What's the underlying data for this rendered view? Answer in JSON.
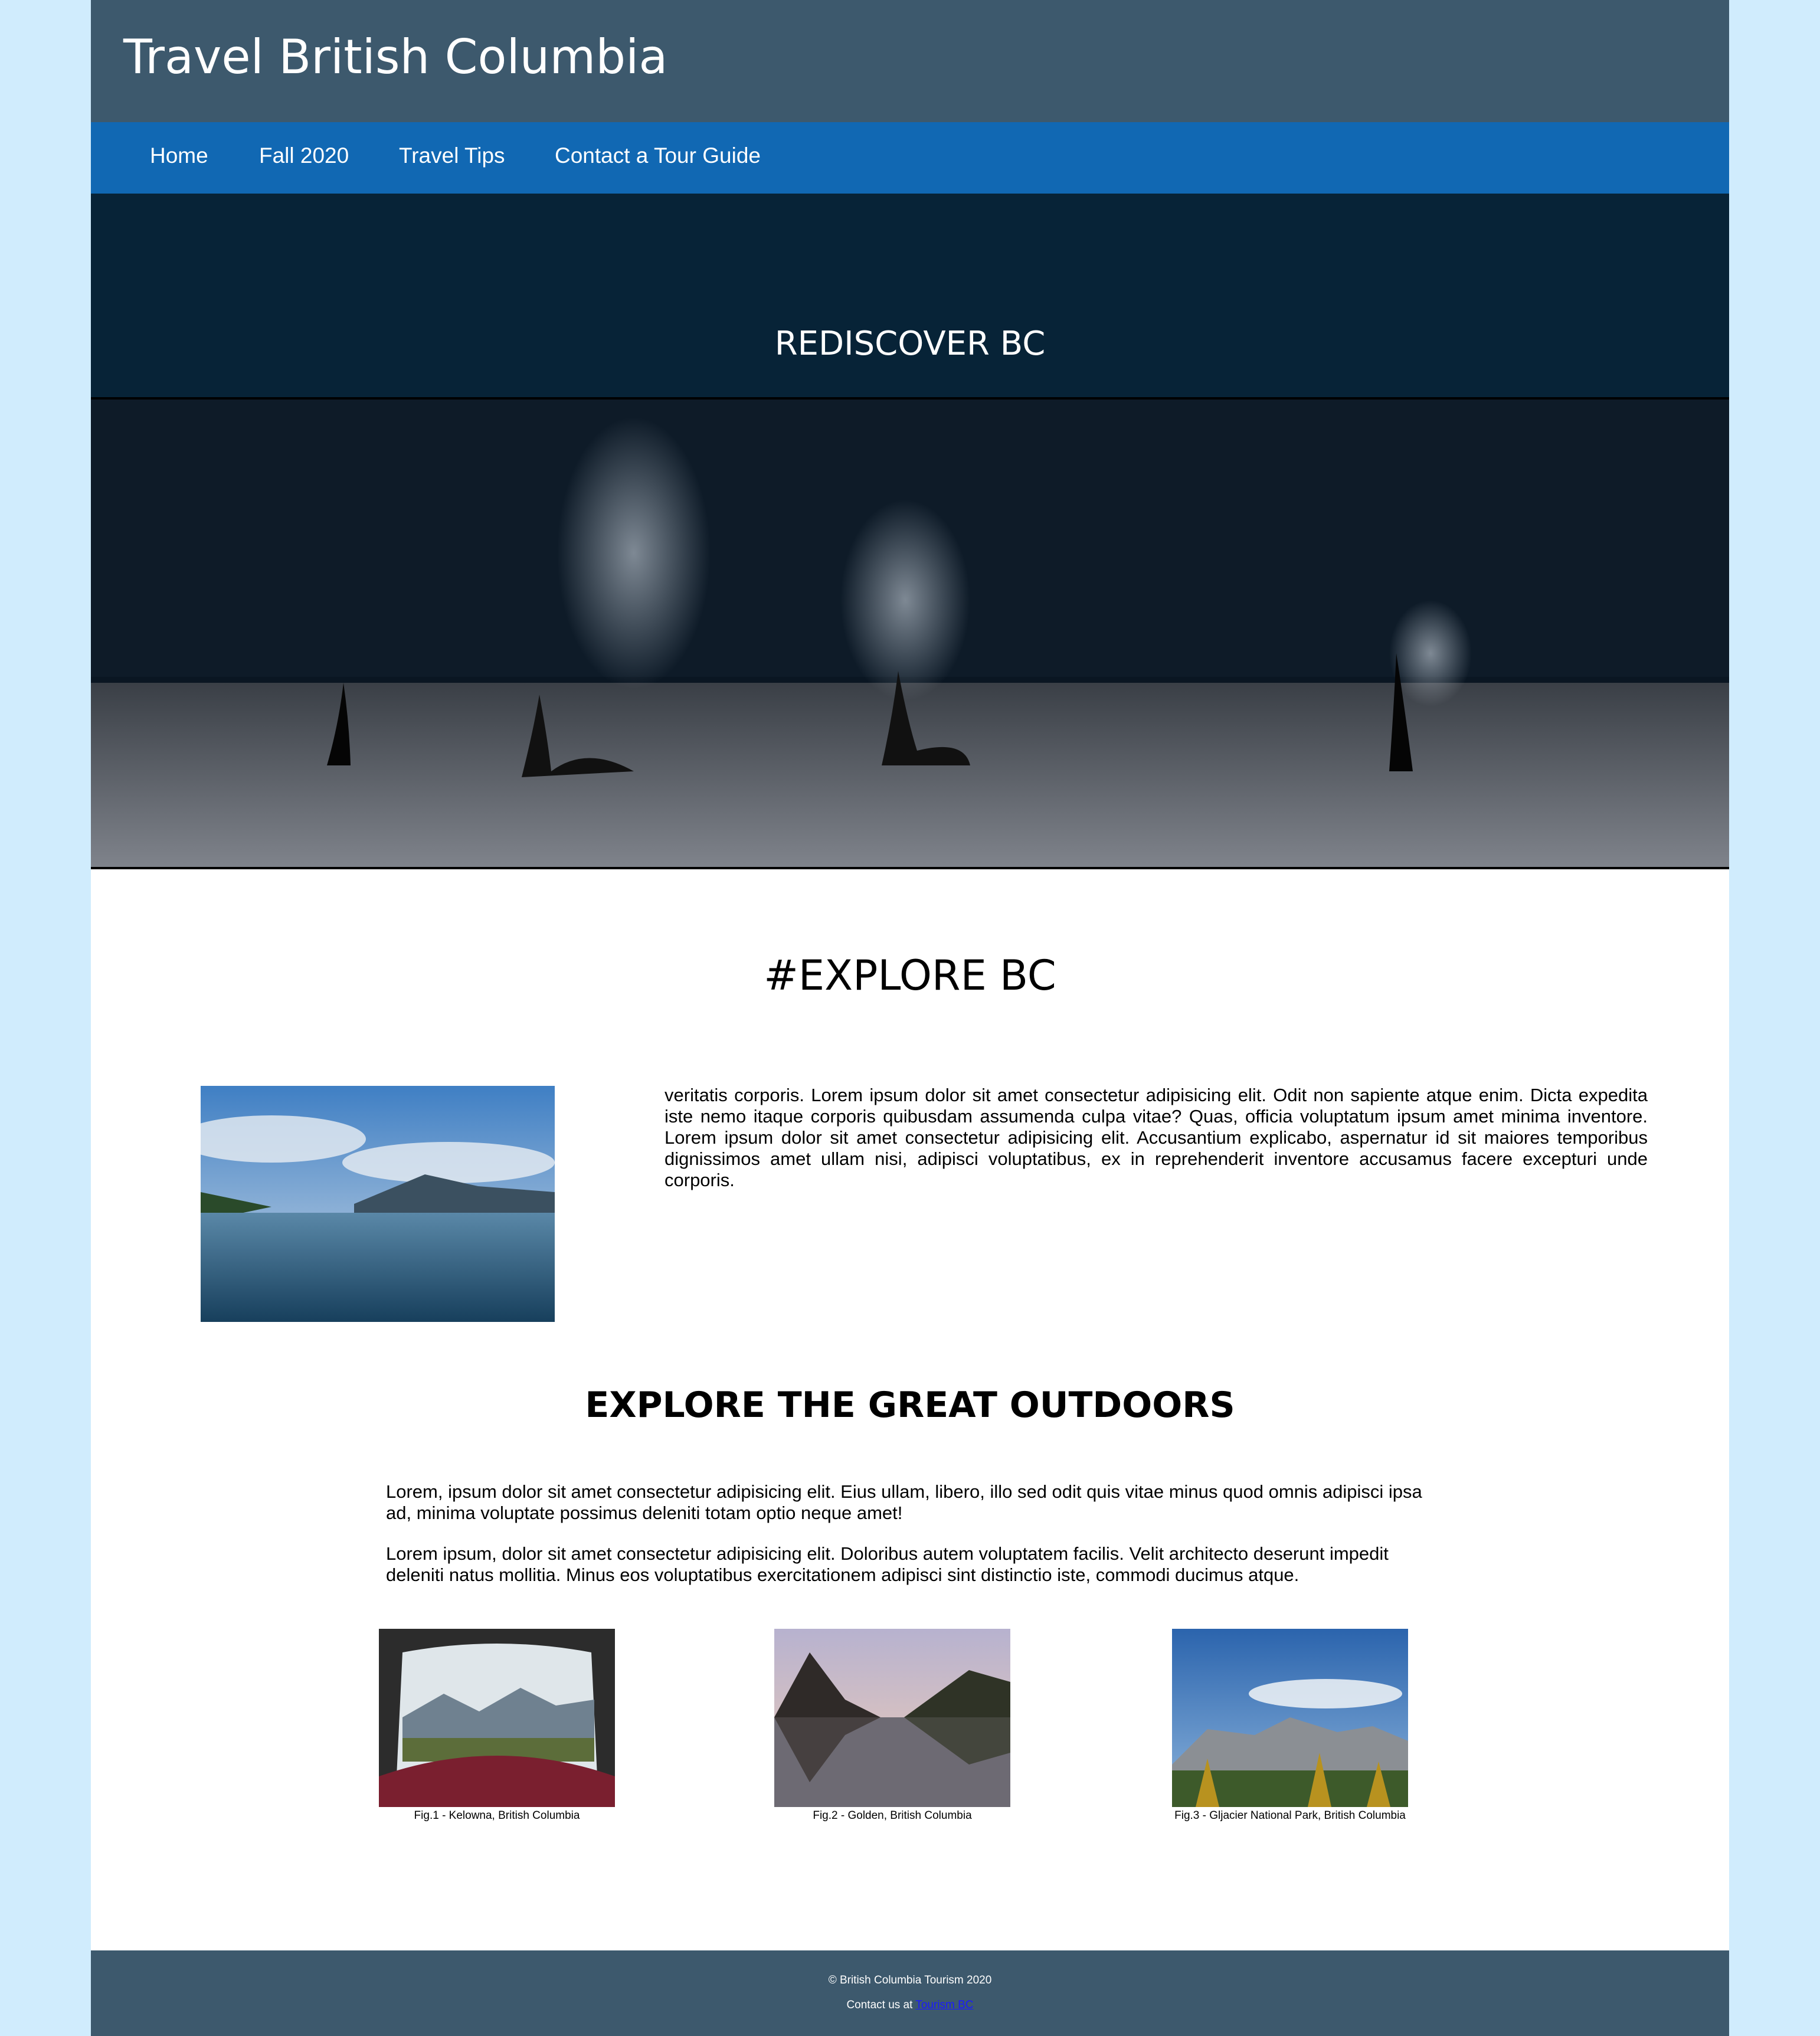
{
  "header": {
    "title": "Travel British Columbia"
  },
  "nav": {
    "items": [
      "Home",
      "Fall 2020",
      "Travel Tips",
      "Contact a Tour Guide"
    ]
  },
  "hero": {
    "title": "REDISCOVER BC"
  },
  "explore": {
    "title": "#EXPLORE BC",
    "text": "veritatis corporis. Lorem ipsum dolor sit amet consectetur adipisicing elit. Odit non sapiente atque enim. Dicta expedita iste nemo itaque corporis quibusdam assumenda culpa vitae? Quas, officia voluptatum ipsum amet minima inventore. Lorem ipsum dolor sit amet consectetur adipisicing elit. Accusantium explicabo, aspernatur id sit maiores temporibus dignissimos amet ullam nisi, adipisci voluptatibus, ex in reprehenderit inventore accusamus facere excepturi unde corporis."
  },
  "outdoors": {
    "title": "EXPLORE THE GREAT OUTDOORS",
    "paragraphs": [
      "Lorem, ipsum dolor sit amet consectetur adipisicing elit. Eius ullam, libero, illo sed odit quis vitae minus quod omnis adipisci ipsa ad, minima voluptate possimus deleniti totam optio neque amet!",
      "Lorem ipsum, dolor sit amet consectetur adipisicing elit. Doloribus autem voluptatem facilis. Velit architecto deserunt impedit deleniti natus mollitia. Minus eos voluptatibus exercitationem adipisci sint distinctio iste, commodi ducimus atque."
    ]
  },
  "figures": [
    {
      "caption": "Fig.1 - Kelowna, British Columbia"
    },
    {
      "caption": "Fig.2 - Golden, British Columbia"
    },
    {
      "caption": "Fig.3 - Gljacier National Park, British Columbia"
    }
  ],
  "footer": {
    "copyright": "© British Columbia Tourism 2020",
    "contact_prefix": "Contact us at",
    "contact_link": "Tourism BC"
  },
  "colors": {
    "background": "#d0ecfd",
    "header": "#3d596d",
    "nav": "#1168b3",
    "hero_band": "#072337",
    "link": "#1a1aff"
  }
}
